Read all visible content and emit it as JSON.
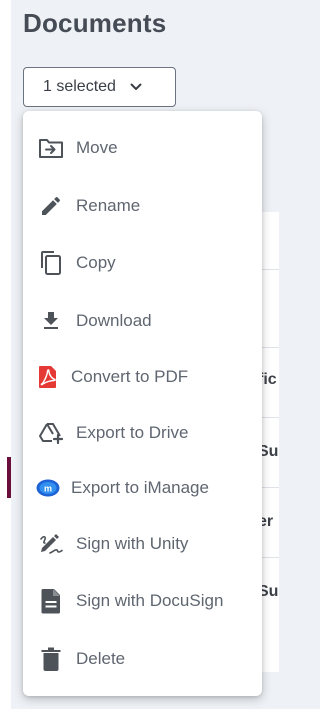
{
  "header": {
    "title": "Documents"
  },
  "selection_button": {
    "label": "1 selected",
    "icon": "chevron-down-icon"
  },
  "menu": {
    "items": [
      {
        "label": "Move",
        "icon": "move-to-folder-icon"
      },
      {
        "label": "Rename",
        "icon": "pencil-icon"
      },
      {
        "label": "Copy",
        "icon": "copy-icon"
      },
      {
        "label": "Download",
        "icon": "download-icon"
      },
      {
        "label": "Convert to PDF",
        "icon": "pdf-icon"
      },
      {
        "label": "Export to Drive",
        "icon": "drive-add-icon"
      },
      {
        "label": "Export to iManage",
        "icon": "imanage-icon"
      },
      {
        "label": "Sign with Unity",
        "icon": "signature-icon"
      },
      {
        "label": "Sign with DocuSign",
        "icon": "document-icon"
      },
      {
        "label": "Delete",
        "icon": "trash-icon"
      }
    ]
  },
  "background_table": {
    "cells": [
      "fic",
      "Su",
      "er",
      "Su"
    ]
  },
  "colors": {
    "accent": "#6a0f3b",
    "icon": "#4d5358",
    "pdf_red": "#e53935",
    "imanage_blue": "#1e62d6"
  }
}
